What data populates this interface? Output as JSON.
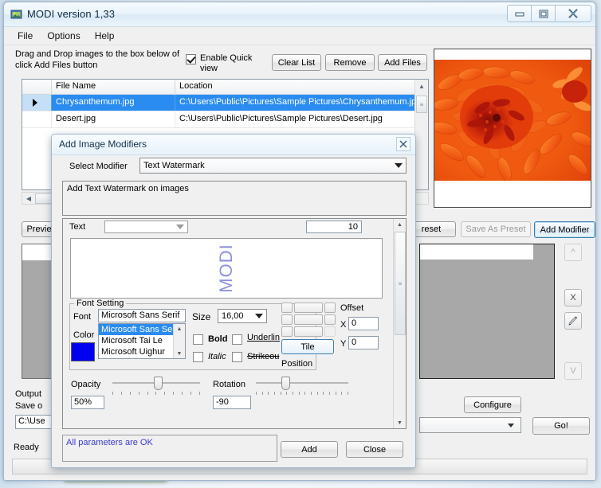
{
  "window": {
    "title": "MODI version 1,33",
    "icon": "app-icon",
    "minimize": "–",
    "maximize": "❐",
    "close": "✕"
  },
  "menu": {
    "items": [
      "File",
      "Options",
      "Help"
    ]
  },
  "toolbar": {
    "hint": "Drag and Drop images to the box below of click Add Files button",
    "quickview_label": "Enable Quick view",
    "quickview_checked": true,
    "clear_list": "Clear List",
    "remove": "Remove",
    "add_files": "Add Files"
  },
  "filelist": {
    "columns": [
      "",
      "File Name",
      "Location"
    ],
    "rows": [
      {
        "marker": "▶",
        "name": "Chrysanthemum.jpg",
        "location": "C:\\Users\\Public\\Pictures\\Sample Pictures\\Chrysanthemum.jpg",
        "selected": true
      },
      {
        "marker": "",
        "name": "Desert.jpg",
        "location": "C:\\Users\\Public\\Pictures\\Sample Pictures\\Desert.jpg",
        "selected": false
      }
    ]
  },
  "left_panel": {
    "preview_button": "Preview",
    "output_label": "Output",
    "save_label": "Save o",
    "output_path": "C:\\Use",
    "status": "Ready"
  },
  "presets": {
    "load_preset": "reset",
    "save_as_preset": "Save As Preset",
    "add_modifier": "Add Modifier"
  },
  "side_buttons": {
    "up": "^",
    "delete": "X",
    "edit": "✎",
    "down": "V"
  },
  "bottom": {
    "configure": "Configure",
    "format_value": "",
    "go": "Go!"
  },
  "dialog": {
    "title": "Add Image Modifiers",
    "close_icon": "✕",
    "select_modifier_label": "Select Modifier",
    "select_modifier_value": "Text Watermark",
    "description": "Add Text Watermark on images",
    "text_label": "Text",
    "text_value": "",
    "count_value": "10",
    "watermark_preview_text": "MODI",
    "font_group_label": "Font Setting",
    "font_label": "Font",
    "font_value": "Microsoft Sans Serif",
    "font_options": [
      "Microsoft Sans Se",
      "Microsoft Tai Le",
      "Microsoft Uighur"
    ],
    "font_selected_index": 0,
    "size_label": "Size",
    "size_value": "16,00",
    "color_label": "Color",
    "color_value": "#0000f0",
    "style_bold": "Bold",
    "style_italic": "Italic",
    "style_underline": "Underlin",
    "style_strikeout": "Strikeou",
    "bold_checked": false,
    "italic_checked": false,
    "underline_checked": false,
    "strikeout_checked": false,
    "offset_label": "Offset",
    "offset_x_label": "X",
    "offset_x_value": "0",
    "offset_y_label": "Y",
    "offset_y_value": "0",
    "tile_button": "Tile",
    "position_label": "Position",
    "opacity_label": "Opacity",
    "opacity_value": "50%",
    "rotation_label": "Rotation",
    "rotation_value": "-90",
    "message": "All parameters are OK",
    "add_button": "Add",
    "close_button": "Close"
  }
}
